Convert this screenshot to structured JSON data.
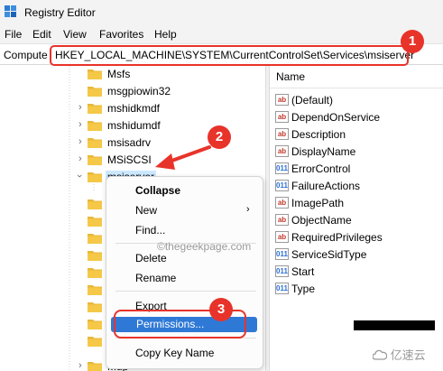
{
  "window": {
    "title": "Registry Editor"
  },
  "menu": {
    "items": [
      "File",
      "Edit",
      "View",
      "Favorites",
      "Help"
    ]
  },
  "address": {
    "prefix": "Compute",
    "path": "HKEY_LOCAL_MACHINE\\SYSTEM\\CurrentControlSet\\Services\\msiserver"
  },
  "tree": {
    "items": [
      {
        "label": "Msfs",
        "expandable": false
      },
      {
        "label": "msgpiowin32",
        "expandable": false
      },
      {
        "label": "mshidkmdf",
        "expandable": true
      },
      {
        "label": "mshidumdf",
        "expandable": true
      },
      {
        "label": "msisadrv",
        "expandable": true
      },
      {
        "label": "MSiSCSI",
        "expandable": true
      },
      {
        "label": "msiserver",
        "expandable": true,
        "expanded": true,
        "selected": true
      }
    ],
    "partial_last": "Mup"
  },
  "values_pane": {
    "column_name": "Name",
    "values": [
      {
        "name": "(Default)",
        "type": "ab"
      },
      {
        "name": "DependOnService",
        "type": "ab"
      },
      {
        "name": "Description",
        "type": "ab"
      },
      {
        "name": "DisplayName",
        "type": "ab"
      },
      {
        "name": "ErrorControl",
        "type": "bin"
      },
      {
        "name": "FailureActions",
        "type": "bin"
      },
      {
        "name": "ImagePath",
        "type": "ab"
      },
      {
        "name": "ObjectName",
        "type": "ab"
      },
      {
        "name": "RequiredPrivileges",
        "type": "ab"
      },
      {
        "name": "ServiceSidType",
        "type": "bin"
      },
      {
        "name": "Start",
        "type": "bin"
      },
      {
        "name": "Type",
        "type": "bin"
      }
    ]
  },
  "context_menu": {
    "collapse": "Collapse",
    "new": "New",
    "find": "Find...",
    "delete": "Delete",
    "rename": "Rename",
    "export": "Export",
    "permissions": "Permissions...",
    "copy_key_name": "Copy Key Name"
  },
  "annotations": {
    "badge1": "1",
    "badge2": "2",
    "badge3": "3"
  },
  "watermark": "©thegeekpage.com",
  "logo_text": "亿速云",
  "colors": {
    "annotation_red": "#e8332a",
    "highlight_blue": "#2f79d6",
    "selection": "#cce8ff",
    "folder": "#e8b83a"
  }
}
